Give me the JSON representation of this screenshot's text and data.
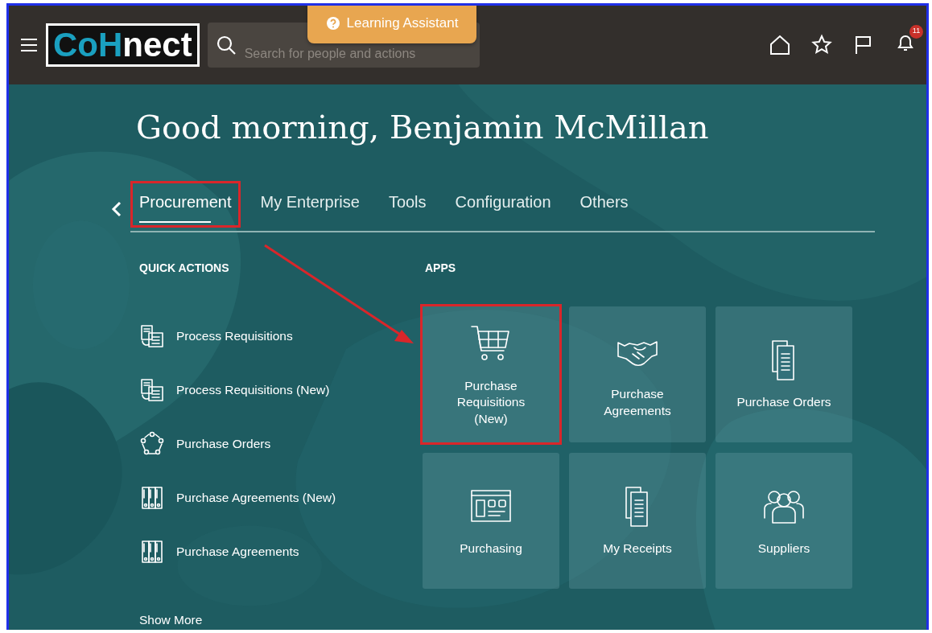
{
  "header": {
    "logo": [
      {
        "text": "CoH",
        "accent": true
      },
      {
        "text": "nect",
        "accent": false
      }
    ],
    "search": {
      "placeholder": "Search for people and actions"
    },
    "learning_assistant": "Learning Assistant",
    "notification_count": "11"
  },
  "greeting": "Good morning, Benjamin McMillan",
  "tabs": [
    {
      "label": "Procurement",
      "selected": true,
      "highlighted": true
    },
    {
      "label": "My Enterprise",
      "selected": false,
      "highlighted": false
    },
    {
      "label": "Tools",
      "selected": false,
      "highlighted": false
    },
    {
      "label": "Configuration",
      "selected": false,
      "highlighted": false
    },
    {
      "label": "Others",
      "selected": false,
      "highlighted": false
    }
  ],
  "quick_actions": {
    "title": "QUICK ACTIONS",
    "items": [
      {
        "label": "Process Requisitions",
        "kind": "documents"
      },
      {
        "label": "Process Requisitions (New)",
        "kind": "documents"
      },
      {
        "label": "Purchase Orders",
        "kind": "cycle"
      },
      {
        "label": "Purchase Agreements (New)",
        "kind": "binders"
      },
      {
        "label": "Purchase Agreements",
        "kind": "binders"
      }
    ],
    "show_more": "Show More"
  },
  "apps": {
    "title": "APPS",
    "tiles": [
      {
        "label": "Purchase Requisitions (New)",
        "kind": "cart",
        "highlighted": true
      },
      {
        "label": "Purchase Agreements",
        "kind": "handshake",
        "highlighted": false
      },
      {
        "label": "Purchase Orders",
        "kind": "pages",
        "highlighted": false
      },
      {
        "label": "Purchasing",
        "kind": "dashboard",
        "highlighted": false
      },
      {
        "label": "My Receipts",
        "kind": "pages",
        "highlighted": false
      },
      {
        "label": "Suppliers",
        "kind": "people",
        "highlighted": false
      }
    ]
  },
  "annotations": [
    {
      "kind": "arrow"
    }
  ]
}
